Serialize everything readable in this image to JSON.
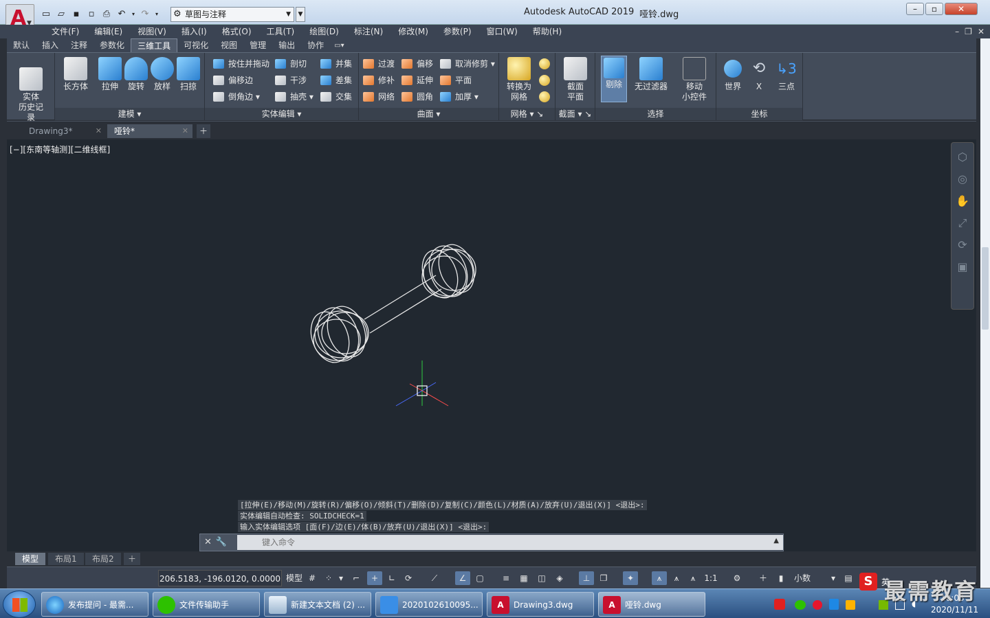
{
  "app": {
    "app_title": "Autodesk AutoCAD 2019",
    "doc_title": "哑铃.dwg",
    "workspace": "草图与注释"
  },
  "menubar": [
    "文件(F)",
    "编辑(E)",
    "视图(V)",
    "插入(I)",
    "格式(O)",
    "工具(T)",
    "绘图(D)",
    "标注(N)",
    "修改(M)",
    "参数(P)",
    "窗口(W)",
    "帮助(H)"
  ],
  "ribbon_tabs": [
    "默认",
    "插入",
    "注释",
    "参数化",
    "三维工具",
    "可视化",
    "视图",
    "管理",
    "输出",
    "协作"
  ],
  "active_ribbon_tab": "三维工具",
  "ribbon": {
    "history": {
      "label": "实体\n历史记录"
    },
    "modeling": {
      "title": "建模",
      "buttons": [
        "长方体",
        "拉伸",
        "旋转",
        "放样",
        "扫掠"
      ]
    },
    "solid_edit": {
      "title": "实体编辑",
      "items": [
        "按住并拖动",
        "偏移边",
        "倒角边",
        "剖切",
        "干涉",
        "抽壳",
        "并集",
        "差集",
        "交集"
      ]
    },
    "surface": {
      "title": "曲面",
      "items": [
        "过渡",
        "修补",
        "网络",
        "偏移",
        "延伸",
        "圆角",
        "取消修剪",
        "平面",
        "加厚"
      ]
    },
    "mesh": {
      "title": "网格",
      "button": "转换为\n网格"
    },
    "section": {
      "title": "截面",
      "button": "截面\n平面"
    },
    "selection": {
      "title": "选择",
      "buttons": [
        "剔除",
        "无过滤器",
        "移动\n小控件"
      ]
    },
    "ucs": {
      "title": "坐标",
      "buttons": [
        "世界",
        "X",
        "三点"
      ]
    }
  },
  "file_tabs": [
    "Drawing3*",
    "哑铃*"
  ],
  "viewport_label": "[−][东南等轴测][二维线框]",
  "command_history": [
    "[拉伸(E)/移动(M)/旋转(R)/偏移(O)/倾斜(T)/删除(D)/复制(C)/颜色(L)/材质(A)/放弃(U)/退出(X)] <退出>:",
    "实体编辑自动检查:  SOLIDCHECK=1",
    "输入实体编辑选项 [面(F)/边(E)/体(B)/放弃(U)/退出(X)] <退出>:"
  ],
  "command_placeholder": "键入命令",
  "layout_tabs": [
    "模型",
    "布局1",
    "布局2"
  ],
  "statusbar": {
    "coords": "206.5183, -196.0120, 0.0000",
    "model": "模型",
    "scale": "1:1",
    "units": "小数"
  },
  "taskbar": {
    "tasks": [
      "发布提问 - 最需...",
      "文件传输助手",
      "新建文本文档 (2) ...",
      "2020102610095...",
      "Drawing3.dwg",
      "哑铃.dwg"
    ],
    "ime": "英",
    "time": "10:03",
    "date": "2020/11/11"
  },
  "watermark": "最需教育",
  "colors": {
    "accent": "#5b7aa3",
    "viewport_bg": "#212830",
    "brand_red": "#c8102e"
  },
  "icons": [
    "autocad-logo-icon",
    "new-icon",
    "open-icon",
    "save-icon",
    "saveas-icon",
    "print-icon",
    "undo-icon",
    "redo-icon",
    "gear-icon",
    "windows-start-icon"
  ]
}
